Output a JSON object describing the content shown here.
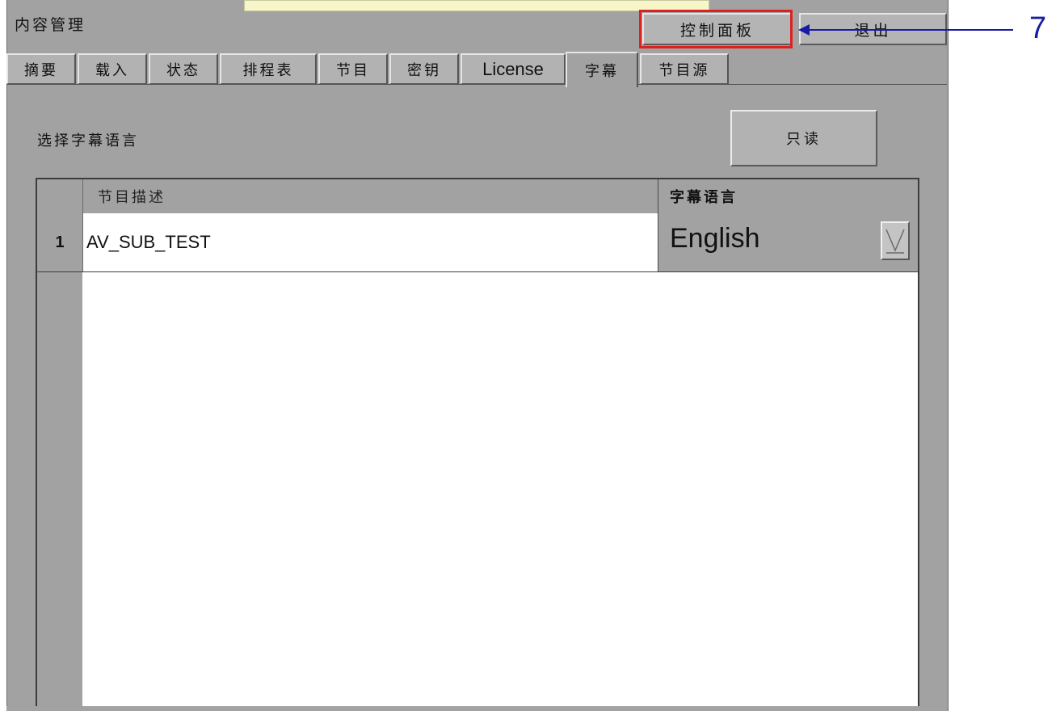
{
  "window": {
    "app_title": "内容管理",
    "control_panel_label": "控制面板",
    "exit_label": "退出"
  },
  "annotation": {
    "callout_number": "7",
    "highlight_color": "#e02020",
    "arrow_color": "#1a1aa8"
  },
  "tabs": [
    {
      "label": "摘要",
      "active": false
    },
    {
      "label": "载入",
      "active": false
    },
    {
      "label": "状态",
      "active": false
    },
    {
      "label": "排程表",
      "active": false
    },
    {
      "label": "节目",
      "active": false
    },
    {
      "label": "密钥",
      "active": false
    },
    {
      "label": "License",
      "active": false
    },
    {
      "label": "字幕",
      "active": true
    },
    {
      "label": "节目源",
      "active": false
    }
  ],
  "subtitle_page": {
    "section_label": "选择字幕语言",
    "readonly_label": "只读",
    "table": {
      "headers": {
        "program_description": "节目描述",
        "subtitle_language": "字幕语言"
      },
      "rows": [
        {
          "number": "1",
          "program_description": "AV_SUB_TEST",
          "subtitle_language": "English"
        }
      ]
    }
  },
  "icons": {
    "dropdown": "dropdown-arrow-icon"
  },
  "colors": {
    "panel_gray": "#a2a2a2",
    "button_gray": "#b4b4b4"
  }
}
